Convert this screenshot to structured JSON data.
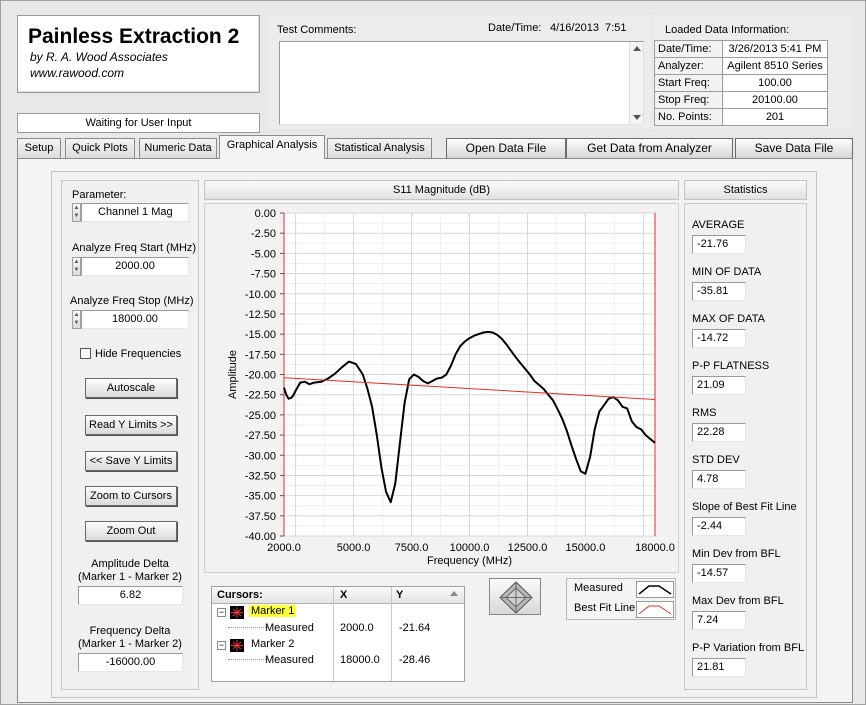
{
  "app": {
    "title": "Painless Extraction 2",
    "company": "by R. A. Wood Associates",
    "website": "www.rawood.com",
    "status": "Waiting for User Input"
  },
  "header": {
    "test_comments_label": "Test Comments:",
    "datetime_label": "Date/Time:",
    "datetime_value": "4/16/2013  7:51",
    "loaded_info_title": "Loaded Data Information:",
    "loaded_info": [
      {
        "key": "Date/Time:",
        "value": "3/26/2013 5:41 PM"
      },
      {
        "key": "Analyzer:",
        "value": "Agilent 8510 Series"
      },
      {
        "key": "Start Freq:",
        "value": "100.00"
      },
      {
        "key": "Stop Freq:",
        "value": "20100.00"
      },
      {
        "key": "No. Points:",
        "value": "201"
      }
    ]
  },
  "tabs": [
    {
      "label": "Setup"
    },
    {
      "label": "Quick Plots"
    },
    {
      "label": "Numeric Data"
    },
    {
      "label": "Graphical Analysis"
    },
    {
      "label": "Statistical Analysis"
    }
  ],
  "toolbar": {
    "open_label": "Open Data File",
    "get_label": "Get Data from Analyzer",
    "save_label": "Save Data File"
  },
  "left": {
    "parameter_label": "Parameter:",
    "parameter_value": "Channel 1 Mag",
    "start_label": "Analyze Freq Start (MHz)",
    "start_value": "2000.00",
    "stop_label": "Analyze Freq Stop (MHz)",
    "stop_value": "18000.00",
    "hide_freq_label": "Hide Frequencies",
    "hide_freq_checked": false,
    "autoscale_label": "Autoscale",
    "read_y_label": "Read Y Limits >>",
    "save_y_label": "<< Save Y Limits",
    "zoom_cursors_label": "Zoom to Cursors",
    "zoom_out_label": "Zoom Out",
    "amp_delta_label1": "Amplitude Delta",
    "amp_delta_label2": "(Marker 1 - Marker 2)",
    "amp_delta_value": "6.82",
    "freq_delta_label1": "Frequency Delta",
    "freq_delta_label2": "(Marker 1 - Marker 2)",
    "freq_delta_value": "-16000.00"
  },
  "cursors": {
    "header": "Cursors:",
    "col_x": "X",
    "col_y": "Y",
    "rows": [
      {
        "name": "Marker 1",
        "trace": "Measured",
        "x": "2000.0",
        "y": "-21.64"
      },
      {
        "name": "Marker 2",
        "trace": "Measured",
        "x": "18000.0",
        "y": "-28.46"
      }
    ]
  },
  "legend": {
    "measured": "Measured",
    "best_fit": "Best Fit Line",
    "measured_color": "#000000",
    "best_fit_color": "#e0302a"
  },
  "statistics": {
    "title": "Statistics",
    "items": [
      {
        "label": "AVERAGE",
        "value": "-21.76"
      },
      {
        "label": "MIN OF DATA",
        "value": "-35.81"
      },
      {
        "label": "MAX OF DATA",
        "value": "-14.72"
      },
      {
        "label": "P-P FLATNESS",
        "value": "21.09"
      },
      {
        "label": "RMS",
        "value": "22.28"
      },
      {
        "label": "STD DEV",
        "value": "4.78"
      },
      {
        "label": "Slope of Best Fit Line",
        "value": "-2.44"
      },
      {
        "label": "Min Dev from BFL",
        "value": "-14.57"
      },
      {
        "label": "Max Dev from BFL",
        "value": "7.24"
      },
      {
        "label": "P-P Variation from BFL",
        "value": "21.81"
      }
    ]
  },
  "chart_data": {
    "type": "line",
    "title": "S11 Magnitude (dB)",
    "xlabel": "Frequency (MHz)",
    "ylabel": "Amplitude",
    "xlim": [
      2000,
      18000
    ],
    "ylim": [
      -40,
      0
    ],
    "x_ticks": [
      "2000.0",
      "5000.0",
      "7500.0",
      "10000.0",
      "12500.0",
      "15000.0",
      "18000.0"
    ],
    "y_ticks": [
      "0.00",
      "-2.50",
      "-5.00",
      "-7.50",
      "-10.00",
      "-12.50",
      "-15.00",
      "-17.50",
      "-20.00",
      "-22.50",
      "-25.00",
      "-27.50",
      "-30.00",
      "-32.50",
      "-35.00",
      "-37.50",
      "-40.00"
    ],
    "grid": true,
    "series": [
      {
        "name": "Measured",
        "x": [
          2000,
          2100,
          2200,
          2300,
          2400,
          2500,
          2700,
          2900,
          3100,
          3300,
          3600,
          3900,
          4200,
          4500,
          4800,
          5100,
          5400,
          5600,
          5800,
          6000,
          6200,
          6400,
          6600,
          6800,
          7000,
          7200,
          7400,
          7600,
          7800,
          8000,
          8200,
          8400,
          8600,
          8800,
          9000,
          9200,
          9400,
          9600,
          9800,
          10000,
          10200,
          10400,
          10600,
          10800,
          11000,
          11200,
          11400,
          11600,
          11800,
          12000,
          12200,
          12400,
          12600,
          12800,
          13000,
          13200,
          13400,
          13600,
          13800,
          14000,
          14200,
          14400,
          14600,
          14800,
          15000,
          15200,
          15400,
          15600,
          15800,
          16000,
          16200,
          16400,
          16600,
          16800,
          17000,
          17200,
          17400,
          17600,
          17800,
          18000
        ],
        "values": [
          -21.64,
          -22.5,
          -23.0,
          -22.9,
          -22.6,
          -22.0,
          -21.0,
          -20.9,
          -21.2,
          -21.0,
          -20.9,
          -20.5,
          -19.9,
          -19.1,
          -18.4,
          -18.7,
          -20.0,
          -21.8,
          -24.0,
          -27.5,
          -31.5,
          -34.5,
          -35.81,
          -33.5,
          -28.5,
          -23.5,
          -20.6,
          -20.0,
          -20.3,
          -20.8,
          -21.1,
          -20.8,
          -20.5,
          -20.4,
          -20.0,
          -18.9,
          -17.5,
          -16.5,
          -15.9,
          -15.5,
          -15.2,
          -15.0,
          -14.8,
          -14.72,
          -14.8,
          -15.1,
          -15.6,
          -16.3,
          -17.1,
          -17.9,
          -18.6,
          -19.3,
          -20.0,
          -20.8,
          -21.3,
          -21.8,
          -22.5,
          -23.2,
          -24.3,
          -25.5,
          -27.0,
          -28.8,
          -30.5,
          -32.0,
          -32.3,
          -30.2,
          -26.8,
          -24.6,
          -23.8,
          -23.0,
          -22.8,
          -23.2,
          -24.0,
          -24.2,
          -25.8,
          -26.5,
          -26.8,
          -27.5,
          -28.0,
          -28.46
        ]
      },
      {
        "name": "Best Fit Line",
        "x": [
          2000,
          18000
        ],
        "values": [
          -20.4,
          -23.1
        ]
      }
    ]
  }
}
